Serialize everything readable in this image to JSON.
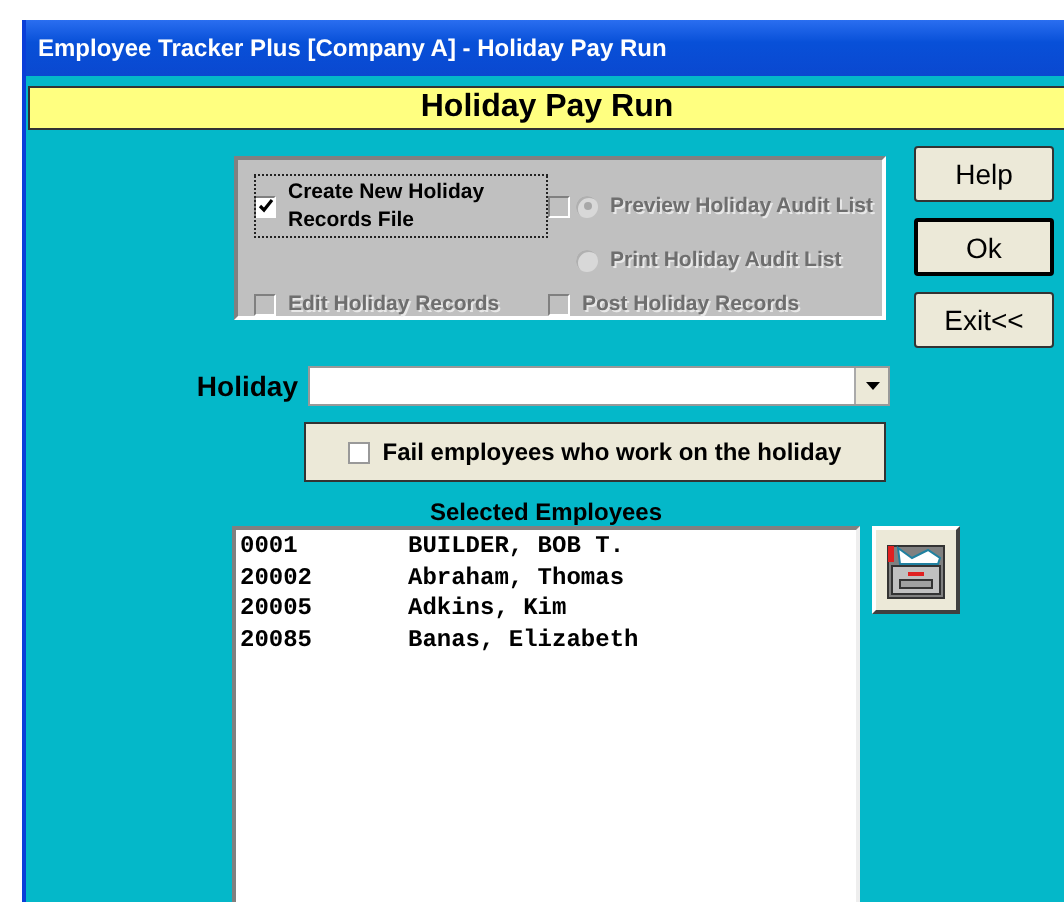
{
  "window": {
    "title": "Employee Tracker Plus [Company A] - Holiday Pay Run"
  },
  "header": "Holiday Pay Run",
  "options": [
    {
      "kind": "checkbox",
      "label": "Create New Holiday Records File",
      "checked": true,
      "disabled": false,
      "focused": true
    },
    {
      "kind": "checkbox",
      "checked": false,
      "disabled": true,
      "focused": false
    },
    {
      "kind": "radio",
      "label": "Preview Holiday Audit List",
      "selected": true,
      "disabled": true,
      "focused": false
    },
    {
      "kind": "radio",
      "label": "Print Holiday Audit List",
      "selected": false,
      "disabled": true,
      "focused": false
    },
    {
      "kind": "checkbox",
      "label": "Edit Holiday Records",
      "checked": false,
      "disabled": true,
      "focused": false
    },
    {
      "kind": "checkbox",
      "label": "Post Holiday Records",
      "checked": false,
      "disabled": true,
      "focused": false
    }
  ],
  "buttons": [
    {
      "label": "Help",
      "default": false
    },
    {
      "label": "Ok",
      "default": true
    },
    {
      "label": "Exit<<",
      "default": false
    }
  ],
  "holiday": {
    "label": "Holiday"
  },
  "fail_option": {
    "label": "Fail employees who work on the holiday",
    "checked": false
  },
  "employees": {
    "title": "Selected Employees",
    "rows": [
      {
        "id": "0001",
        "name": "BUILDER, BOB T."
      },
      {
        "id": "20002",
        "name": "Abraham, Thomas"
      },
      {
        "id": "20005",
        "name": "Adkins, Kim"
      },
      {
        "id": "20085",
        "name": "Banas, Elizabeth"
      }
    ]
  }
}
